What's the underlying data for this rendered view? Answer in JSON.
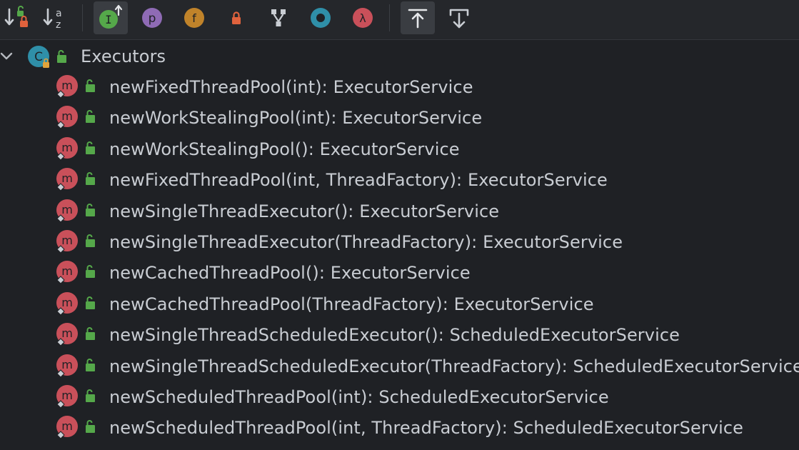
{
  "toolbar": {
    "buttons": [
      {
        "name": "sort-by-visibility-button",
        "icon": "sort-visibility-icon",
        "letter": ""
      },
      {
        "name": "sort-alphabetically-button",
        "icon": "sort-alpha-icon",
        "letter": "a z"
      },
      {
        "name": "show-inherited-button",
        "icon": "inherited-icon",
        "letter": "I",
        "active": true
      },
      {
        "name": "show-properties-button",
        "icon": "property-icon",
        "letter": "p",
        "color": "#8f6bb5"
      },
      {
        "name": "show-fields-button",
        "icon": "field-icon",
        "letter": "f",
        "color": "#c0832a"
      },
      {
        "name": "show-non-public-button",
        "icon": "lock-icon",
        "letter": "",
        "color": "#e0623d"
      },
      {
        "name": "group-by-button",
        "icon": "fork-icon",
        "letter": ""
      },
      {
        "name": "show-anonymous-button",
        "icon": "anonymous-icon",
        "letter": "",
        "color": "#2f8fa8"
      },
      {
        "name": "show-lambdas-button",
        "icon": "lambda-icon",
        "letter": "λ",
        "color": "#c9505a"
      },
      {
        "name": "autoscroll-to-source-button",
        "icon": "scroll-to-source-icon",
        "letter": "",
        "active": true
      },
      {
        "name": "autoscroll-from-source-button",
        "icon": "scroll-from-source-icon",
        "letter": ""
      }
    ]
  },
  "tree": {
    "root": {
      "label": "Executors",
      "class_letter": "C"
    },
    "method_letter": "m",
    "items": [
      {
        "label": "newFixedThreadPool(int): ExecutorService"
      },
      {
        "label": "newWorkStealingPool(int): ExecutorService"
      },
      {
        "label": "newWorkStealingPool(): ExecutorService"
      },
      {
        "label": "newFixedThreadPool(int, ThreadFactory): ExecutorService"
      },
      {
        "label": "newSingleThreadExecutor(): ExecutorService"
      },
      {
        "label": "newSingleThreadExecutor(ThreadFactory): ExecutorService"
      },
      {
        "label": "newCachedThreadPool(): ExecutorService"
      },
      {
        "label": "newCachedThreadPool(ThreadFactory): ExecutorService"
      },
      {
        "label": "newSingleThreadScheduledExecutor(): ScheduledExecutorService"
      },
      {
        "label": "newSingleThreadScheduledExecutor(ThreadFactory): ScheduledExecutorService"
      },
      {
        "label": "newScheduledThreadPool(int): ScheduledExecutorService"
      },
      {
        "label": "newScheduledThreadPool(int, ThreadFactory): ScheduledExecutorService"
      }
    ]
  },
  "colors": {
    "method_badge": "#c9505a",
    "class_badge": "#2f8fa8",
    "public_lock": "#55a84a",
    "text": "#c9cdd3"
  }
}
